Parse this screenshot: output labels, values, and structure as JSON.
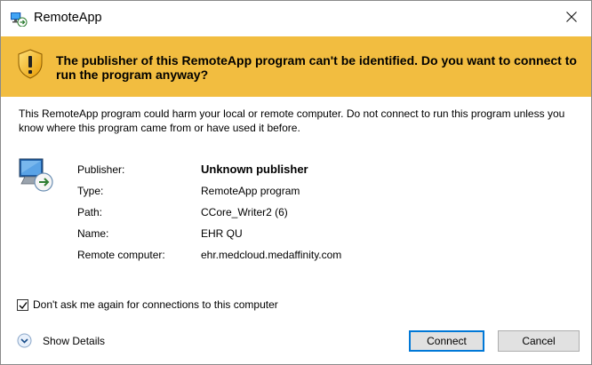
{
  "window": {
    "title": "RemoteApp",
    "close_icon": "close-icon",
    "app_icon": "remoteapp-icon"
  },
  "banner": {
    "icon": "shield-warning-icon",
    "background": "#f2bd40",
    "text": "The publisher of this RemoteApp program can't be identified. Do you want to connect to run the program anyway?"
  },
  "warning_text": "This RemoteApp program could harm your local or remote computer. Do not connect to run this program unless you know where this program came from or have used it before.",
  "details": {
    "icon": "remote-computer-icon",
    "rows": [
      {
        "label": "Publisher:",
        "value": "Unknown publisher"
      },
      {
        "label": "Type:",
        "value": "RemoteApp program"
      },
      {
        "label": "Path:",
        "value": "CCore_Writer2 (6)"
      },
      {
        "label": "Name:",
        "value": "EHR QU"
      },
      {
        "label": "Remote computer:",
        "value": "ehr.medcloud.medaffinity.com"
      }
    ]
  },
  "checkbox": {
    "label": "Don't ask me again for connections to this computer",
    "checked": true
  },
  "show_details": {
    "label": "Show Details",
    "icon": "expand-chevron-icon"
  },
  "buttons": {
    "connect": "Connect",
    "cancel": "Cancel",
    "accent": "#0078d7"
  }
}
